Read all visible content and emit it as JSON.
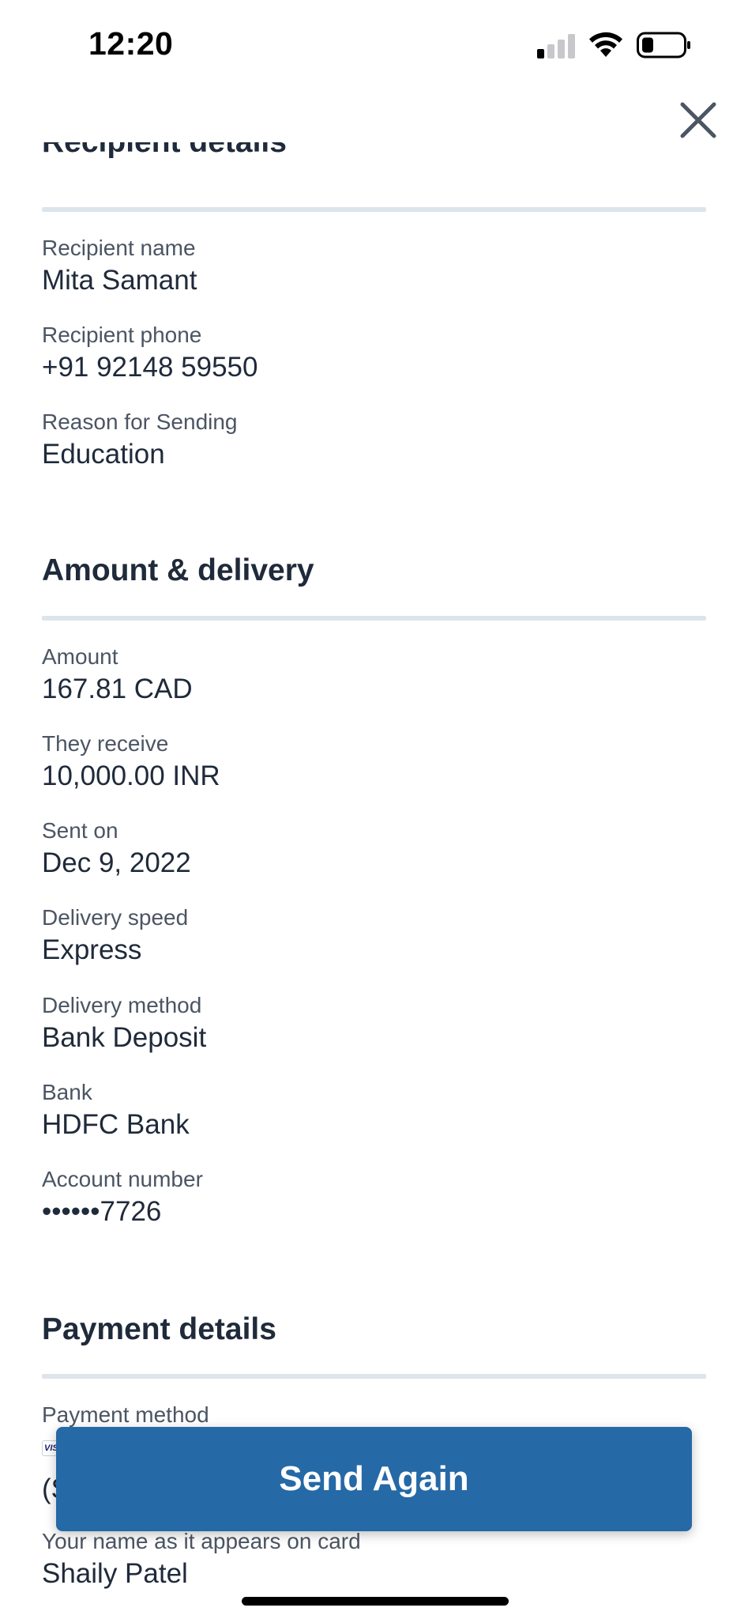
{
  "status_bar": {
    "time": "12:20"
  },
  "recipient_details": {
    "title": "Recipient details",
    "fields": [
      {
        "label": "Recipient name",
        "value": "Mita Samant"
      },
      {
        "label": "Recipient phone",
        "value": "+91 92148 59550"
      },
      {
        "label": "Reason for Sending",
        "value": "Education"
      }
    ]
  },
  "amount_delivery": {
    "title": "Amount & delivery",
    "fields": [
      {
        "label": "Amount",
        "value": "167.81 CAD"
      },
      {
        "label": "They receive",
        "value": "10,000.00 INR"
      },
      {
        "label": "Sent on",
        "value": "Dec 9, 2022"
      },
      {
        "label": "Delivery speed",
        "value": "Express"
      },
      {
        "label": "Delivery method",
        "value": "Bank Deposit"
      },
      {
        "label": "Bank",
        "value": "HDFC Bank"
      },
      {
        "label": "Account number",
        "value": "••••••7726"
      }
    ]
  },
  "payment_details": {
    "title": "Payment details",
    "payment_method_label": "Payment method",
    "card_brand": "VISA",
    "partial_value": "(S",
    "name_label": "Your name as it appears on card",
    "name_value": "Shaily Patel"
  },
  "actions": {
    "send_again_label": "Send Again"
  },
  "colors": {
    "primary": "#2569a6",
    "divider": "#dde4ec",
    "text": "#1f2a3a",
    "label": "#4b5563"
  }
}
